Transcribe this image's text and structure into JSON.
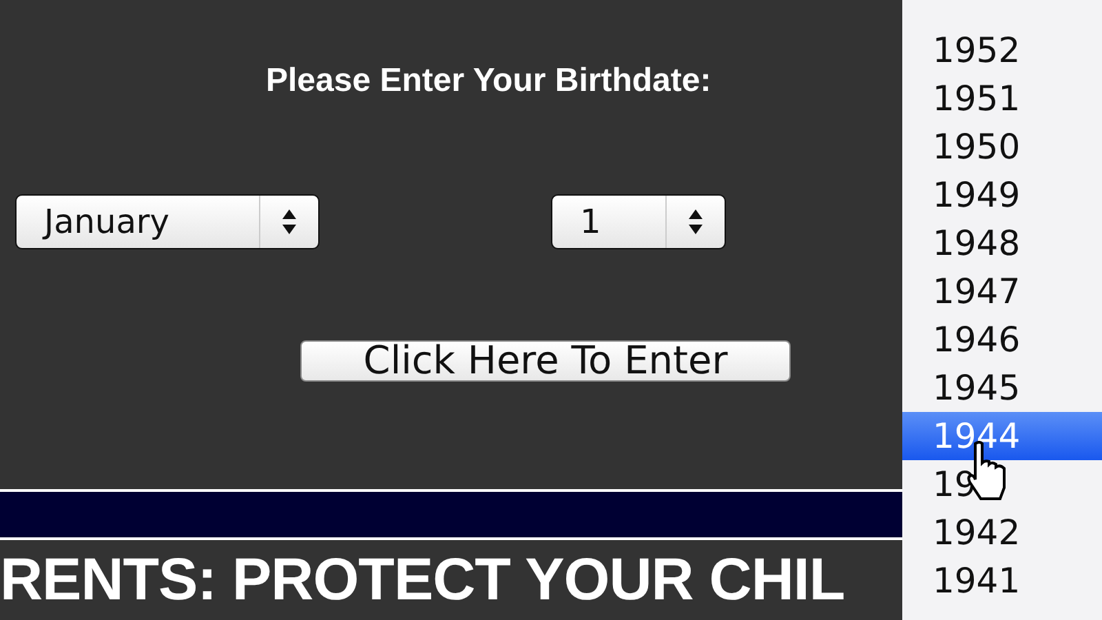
{
  "heading": "Please Enter Your Birthdate:",
  "month_select": {
    "value": "January"
  },
  "day_select": {
    "value": "1"
  },
  "enter_button": {
    "label": "Click Here To Enter"
  },
  "banner": {
    "text": "RENTS: PROTECT YOUR CHIL"
  },
  "year_list": [
    {
      "label": "1952",
      "selected": false
    },
    {
      "label": "1951",
      "selected": false
    },
    {
      "label": "1950",
      "selected": false
    },
    {
      "label": "1949",
      "selected": false
    },
    {
      "label": "1948",
      "selected": false
    },
    {
      "label": "1947",
      "selected": false
    },
    {
      "label": "1946",
      "selected": false
    },
    {
      "label": "1945",
      "selected": false
    },
    {
      "label": "1944",
      "selected": true
    },
    {
      "label": "19",
      "selected": false
    },
    {
      "label": "1942",
      "selected": false
    },
    {
      "label": "1941",
      "selected": false
    }
  ]
}
